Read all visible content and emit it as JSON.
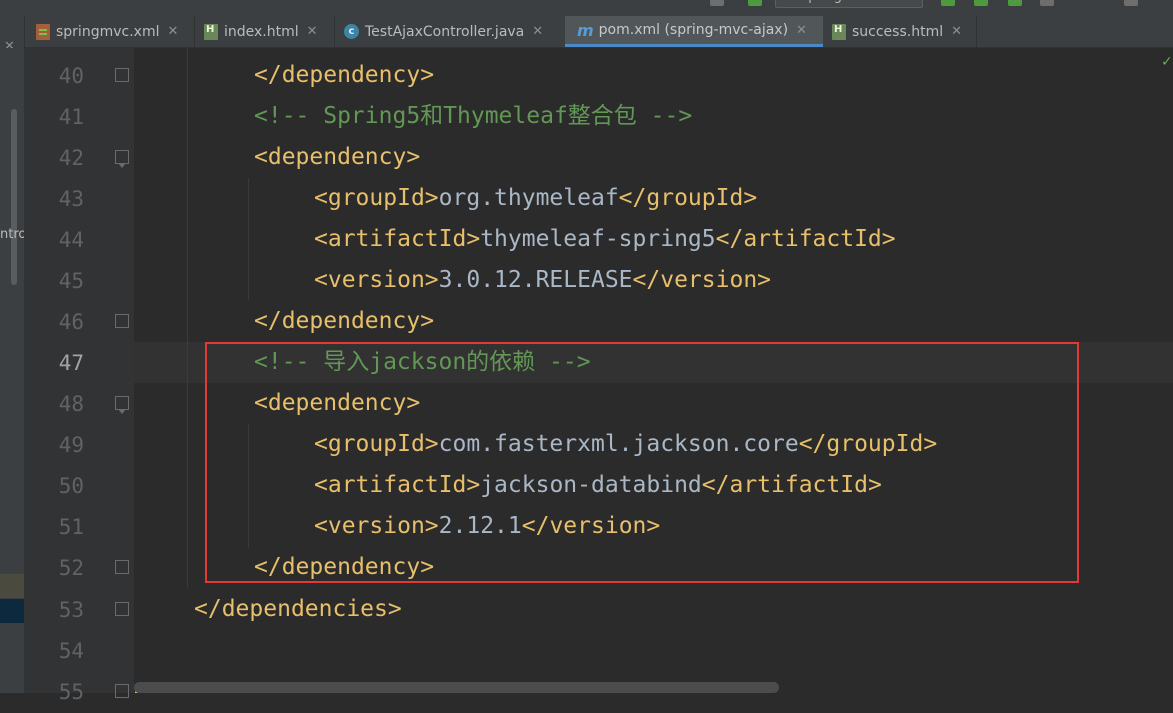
{
  "toolbar": {
    "run_config_label": "SpringMVC"
  },
  "tabs": [
    {
      "label": "springmvc.xml",
      "icon": "xml-file-icon",
      "active": false
    },
    {
      "label": "index.html",
      "icon": "html-file-icon",
      "active": false
    },
    {
      "label": "TestAjaxController.java",
      "icon": "java-class-icon",
      "active": false
    },
    {
      "label": "pom.xml (spring-mvc-ajax)",
      "icon": "maven-file-icon",
      "active": true
    },
    {
      "label": "success.html",
      "icon": "html-file-icon",
      "active": false
    }
  ],
  "side_panel": {
    "fragment_text": "ntro"
  },
  "editor": {
    "current_line": "47",
    "gutter": [
      "40",
      "41",
      "42",
      "43",
      "44",
      "45",
      "46",
      "47",
      "48",
      "49",
      "50",
      "51",
      "52",
      "53",
      "54",
      "55"
    ],
    "lines": [
      {
        "open": "</",
        "tag": "dependency",
        "close": ">"
      },
      {
        "comment": "<!-- Spring5和Thymeleaf整合包 -->"
      },
      {
        "open": "<",
        "tag": "dependency",
        "close": ">"
      },
      {
        "open": "<",
        "tag": "groupId",
        "close": ">",
        "text": "org.thymeleaf",
        "end_open": "</",
        "end_tag": "groupId",
        "end_close": ">"
      },
      {
        "open": "<",
        "tag": "artifactId",
        "close": ">",
        "text": "thymeleaf-spring5",
        "end_open": "</",
        "end_tag": "artifactId",
        "end_close": ">"
      },
      {
        "open": "<",
        "tag": "version",
        "close": ">",
        "text": "3.0.12.RELEASE",
        "end_open": "</",
        "end_tag": "version",
        "end_close": ">"
      },
      {
        "open": "</",
        "tag": "dependency",
        "close": ">"
      },
      {
        "comment": "<!-- 导入jackson的依赖 -->"
      },
      {
        "open": "<",
        "tag": "dependency",
        "close": ">"
      },
      {
        "open": "<",
        "tag": "groupId",
        "close": ">",
        "text": "com.fasterxml.jackson.core",
        "end_open": "</",
        "end_tag": "groupId",
        "end_close": ">"
      },
      {
        "open": "<",
        "tag": "artifactId",
        "close": ">",
        "text": "jackson-databind",
        "end_open": "</",
        "end_tag": "artifactId",
        "end_close": ">"
      },
      {
        "open": "<",
        "tag": "version",
        "close": ">",
        "text": "2.12.1",
        "end_open": "</",
        "end_tag": "version",
        "end_close": ">"
      },
      {
        "open": "</",
        "tag": "dependency",
        "close": ">"
      },
      {
        "open": "</",
        "tag": "dependencies",
        "close": ">"
      },
      {
        "partial": "</project>"
      }
    ]
  },
  "colors": {
    "bracket": "#e8bf6a",
    "tag": "#e8bf6a",
    "comment": "#629755",
    "text": "#a9b7c6",
    "annotation_box": "#e53935",
    "active_tab_underline": "#4a88c7"
  }
}
